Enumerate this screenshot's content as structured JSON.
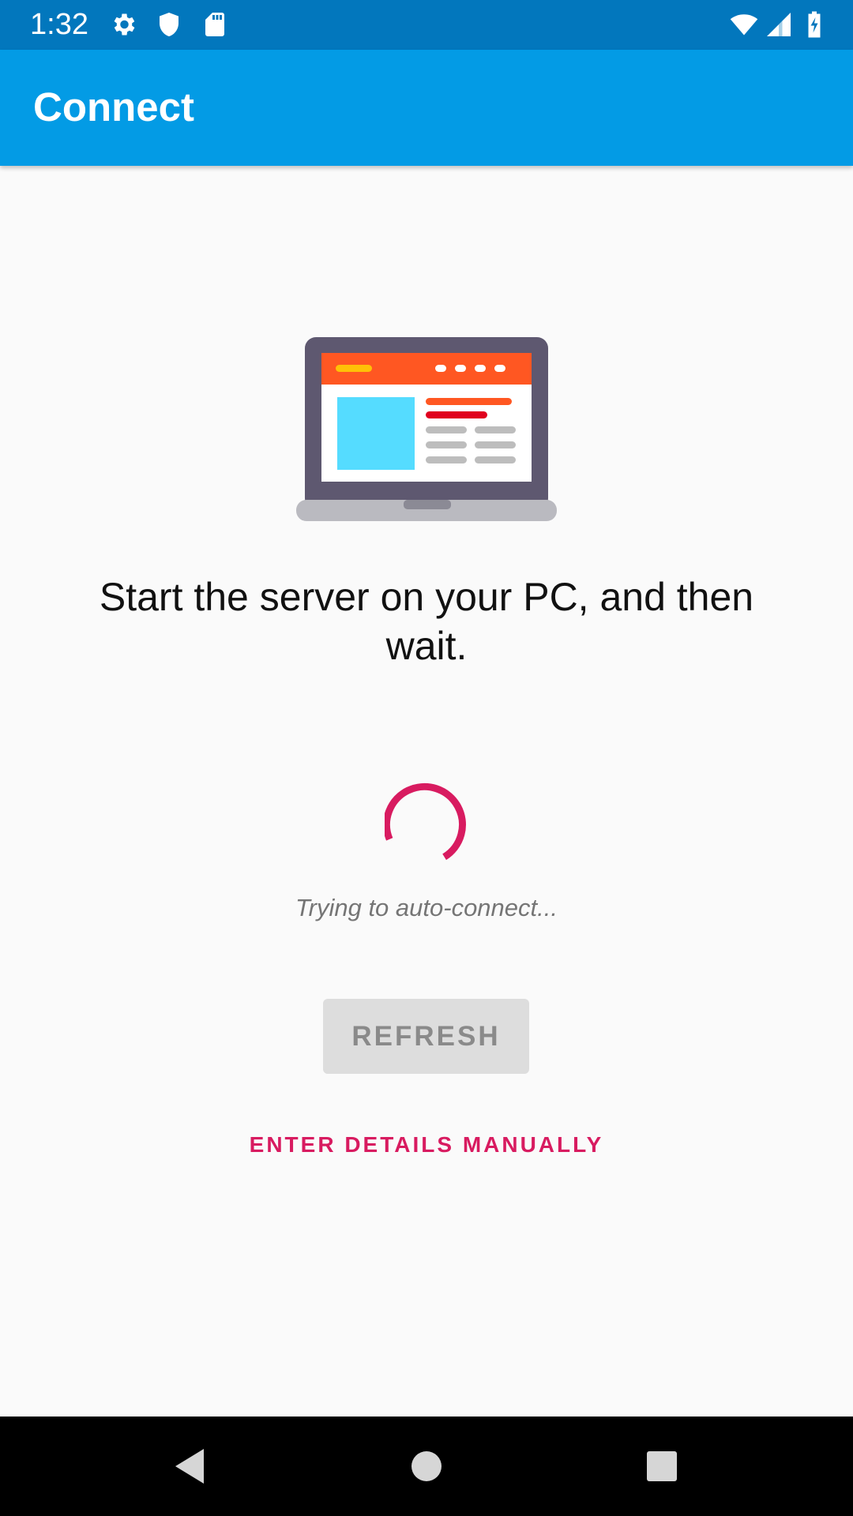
{
  "status_bar": {
    "time": "1:32",
    "icons": [
      "gear-icon",
      "shield-icon",
      "sd-card-icon",
      "wifi-icon",
      "signal-icon",
      "battery-charging-icon"
    ]
  },
  "app_bar": {
    "title": "Connect",
    "background": "#039be5"
  },
  "main": {
    "illustration": "laptop-browser-illustration",
    "message": "Start the server on your PC, and then wait.",
    "spinner": "loading-spinner",
    "status": "Trying to auto-connect...",
    "refresh_label": "REFRESH",
    "manual_label": "ENTER DETAILS MANUALLY",
    "accent": "#d81b60"
  },
  "nav_bar": {
    "buttons": [
      "back-icon",
      "home-icon",
      "recents-icon"
    ]
  }
}
